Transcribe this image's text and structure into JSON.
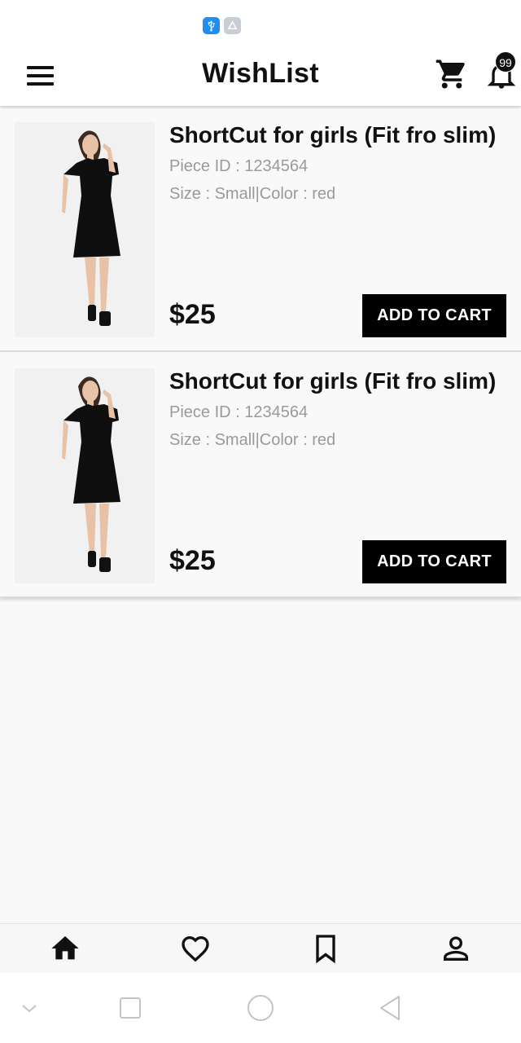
{
  "status_bar": {
    "icons": [
      "usb-icon",
      "android-debug-icon"
    ],
    "colors": {
      "usb": "#1f8ef1",
      "debug": "#c9ced6"
    }
  },
  "header": {
    "title": "WishList",
    "menu_icon": "hamburger-menu-icon",
    "cart_icon": "shopping-cart-icon",
    "bell_icon": "notification-bell-icon",
    "notification_count": "99"
  },
  "wishlist": {
    "items": [
      {
        "title": "ShortCut for girls (Fit fro slim)",
        "piece_id": "Piece ID : 1234564",
        "size_color": "Size : Small|Color : red",
        "price": "$25",
        "button_label": "ADD TO CART",
        "image": "black-dress-product-photo"
      },
      {
        "title": "ShortCut for girls (Fit fro slim)",
        "piece_id": "Piece ID : 1234564",
        "size_color": "Size : Small|Color : red",
        "price": "$25",
        "button_label": "ADD TO CART",
        "image": "black-dress-product-photo"
      }
    ]
  },
  "bottom_nav": {
    "items": [
      "home-icon",
      "heart-icon",
      "bookmark-icon",
      "profile-icon"
    ],
    "active": "home-icon"
  },
  "system_nav": {
    "items": [
      "collapse-chevron-icon",
      "recents-square-icon",
      "home-circle-icon",
      "back-triangle-icon"
    ]
  },
  "colors": {
    "button_bg": "#000000",
    "meta_text": "#9a9a9a",
    "background": "#f8f8f8"
  }
}
